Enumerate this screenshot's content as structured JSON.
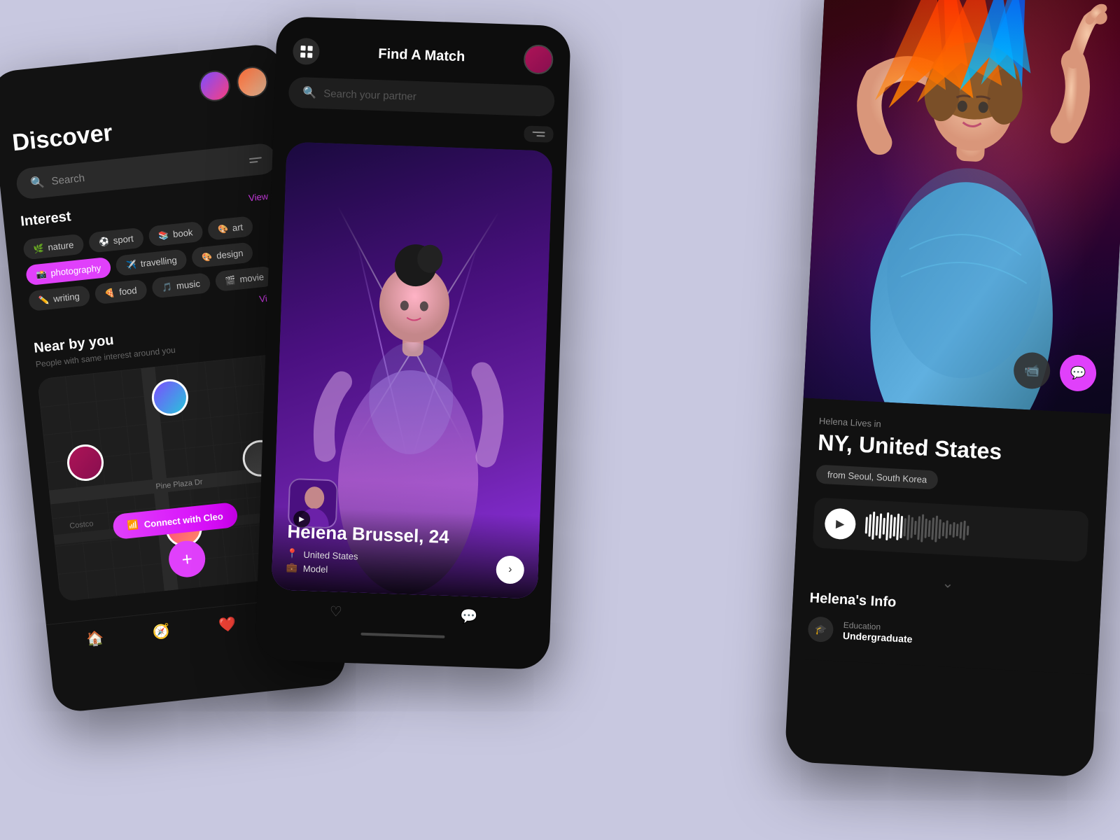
{
  "phone1": {
    "title": "Discover",
    "search_placeholder": "Search",
    "view_all_interest": "View all",
    "view_all_nearby": "View all",
    "interest_title": "Interest",
    "nearby_title": "Near by you",
    "nearby_subtitle": "People with same interest around you",
    "tags": [
      {
        "label": "nature",
        "emoji": "🌿",
        "active": false
      },
      {
        "label": "sport",
        "emoji": "⚽",
        "active": false
      },
      {
        "label": "book",
        "emoji": "📚",
        "active": false
      },
      {
        "label": "art",
        "emoji": "🎨",
        "active": false
      },
      {
        "label": "photography",
        "emoji": "📸",
        "active": true
      },
      {
        "label": "travelling",
        "emoji": "✈️",
        "active": false
      },
      {
        "label": "design",
        "emoji": "🎨",
        "active": false
      },
      {
        "label": "writing",
        "emoji": "✏️",
        "active": false
      },
      {
        "label": "food",
        "emoji": "🍕",
        "active": false
      },
      {
        "label": "music",
        "emoji": "🎵",
        "active": false
      },
      {
        "label": "movie",
        "emoji": "🎬",
        "active": false
      }
    ],
    "map_label": "Pine Plaza Dr",
    "map_label2": "Costco",
    "connect_label": "Connect with Cleo"
  },
  "phone2": {
    "title": "Find A Match",
    "search_placeholder": "Search your partner",
    "profile": {
      "name": "Helena Brussel, 24",
      "location": "United States",
      "profession": "Model",
      "next_btn": "›"
    }
  },
  "phone3": {
    "lives_in_label": "Helena Lives in",
    "location": "NY, United States",
    "from_badge": "from Seoul, South Korea",
    "info_title": "Helena's Info",
    "info_rows": [
      {
        "icon": "🎓",
        "label": "Education",
        "value": "Undergraduate"
      }
    ],
    "audio": {
      "play_icon": "▶"
    }
  },
  "icons": {
    "search": "🔍",
    "home": "🏠",
    "compass": "🧭",
    "heart": "❤️",
    "chat": "💬",
    "video": "📹",
    "play": "▶",
    "chevron_right": "›",
    "chevron_down": "⌄",
    "back": "‹",
    "more": "···",
    "location_pin": "📍",
    "briefcase": "💼",
    "filter": "⚙"
  },
  "colors": {
    "accent": "#e040fb",
    "dark_bg": "#121212",
    "card_bg": "#1e1e1e",
    "text_secondary": "#888888"
  }
}
